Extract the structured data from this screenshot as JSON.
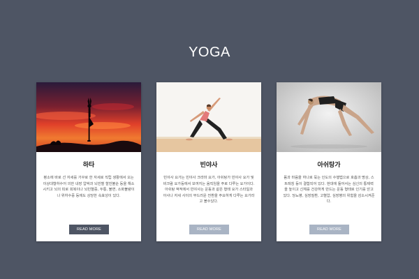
{
  "page": {
    "title": "YOGA"
  },
  "colors": {
    "background": "#4e5564",
    "card": "#ffffff",
    "button_active": "#4e5564",
    "button_muted": "#a9b4c4"
  },
  "cards": [
    {
      "image": "sunset-tree-pose-silhouette",
      "title": "하타",
      "description": "평소에 바로 선 자세를 가꾸로 한 자세로 직립 생활에서 오는 이상대형하수어 의한 내장 압박과 뇌빈혈 할빈불순 등을 해소시키고 뇌의 피로 회복이나 뇌빈혈증, 두통, 불면, 소화불량이나 위하수증 등에도 상당한 속효성이 있다.",
      "button": "READ MORE",
      "button_state": "active"
    },
    {
      "image": "warrior-pose-woman",
      "title": "빈야사",
      "description": "빈야사 요가는 빈야사 크라마 요가, 아쉬탕가 빈야사 요가 및 비크람 요가등에서 보여지는 움직임을 주로 다루는 요가이다. 아쉬탕 액적에서 빈야사는 운동과 같은 형태 요가 스타일과 아사나 자세 사이의 부드러운 전환을 주요하게 다루는 요가라고 볼수있다.",
      "button": "READ MORE",
      "button_state": "muted"
    },
    {
      "image": "wheel-pose-woman",
      "title": "아쉬탕가",
      "description": "몸과 마음을 하나로 묶는 인도의 수행법으로 호흡과 명상, 스트레칭 등이 결합되어 있다. 현대에 들어서는 심신의 통제력을 높이고 신체를 건강하게 만드는 운동 형태로 인기를 얻고 있다. 당뇨병, 심장질환, 고혈압, 심장병의 위험을 감소시켜준다.",
      "button": "READ MORE",
      "button_state": "muted"
    }
  ]
}
